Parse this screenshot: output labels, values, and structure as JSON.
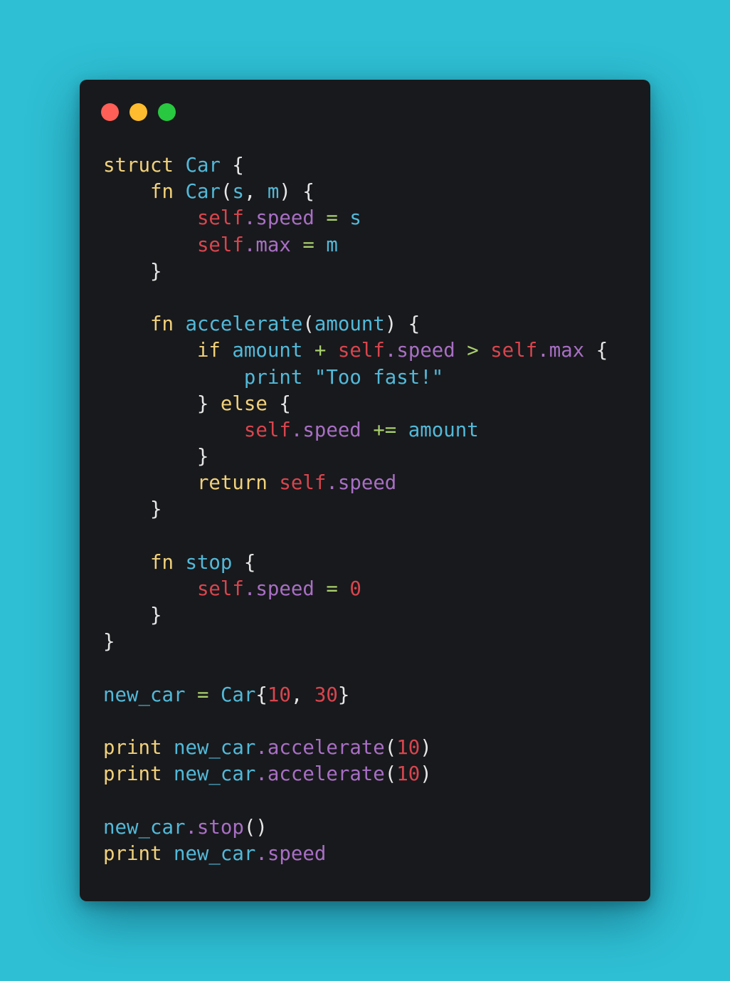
{
  "colors": {
    "background": "#2ebfd4",
    "window": "#18191c",
    "dot_red": "#ff5f57",
    "dot_yellow": "#febc2e",
    "dot_green": "#28c840",
    "plain": "#e6e6e6",
    "keyword": "#f1d17a",
    "name": "#52b9d9",
    "self": "#d8454e",
    "property": "#a86fc4",
    "operator": "#a9cf6d",
    "number": "#d8454e",
    "string": "#52b9d9"
  },
  "window": {
    "buttons": [
      {
        "name": "close-dot",
        "color": "#ff5f57"
      },
      {
        "name": "minimize-dot",
        "color": "#febc2e"
      },
      {
        "name": "maximize-dot",
        "color": "#28c840"
      }
    ]
  },
  "code_lines": [
    [
      [
        "k",
        "struct"
      ],
      [
        "w",
        " "
      ],
      [
        "n",
        "Car"
      ],
      [
        "w",
        " {"
      ]
    ],
    [
      [
        "w",
        "    "
      ],
      [
        "k",
        "fn"
      ],
      [
        "w",
        " "
      ],
      [
        "n",
        "Car"
      ],
      [
        "w",
        "("
      ],
      [
        "n",
        "s"
      ],
      [
        "w",
        ", "
      ],
      [
        "n",
        "m"
      ],
      [
        "w",
        ") {"
      ]
    ],
    [
      [
        "w",
        "        "
      ],
      [
        "s",
        "self"
      ],
      [
        "p",
        ".speed"
      ],
      [
        "w",
        " "
      ],
      [
        "o",
        "="
      ],
      [
        "w",
        " "
      ],
      [
        "n",
        "s"
      ]
    ],
    [
      [
        "w",
        "        "
      ],
      [
        "s",
        "self"
      ],
      [
        "p",
        ".max"
      ],
      [
        "w",
        " "
      ],
      [
        "o",
        "="
      ],
      [
        "w",
        " "
      ],
      [
        "n",
        "m"
      ]
    ],
    [
      [
        "w",
        "    }"
      ]
    ],
    [],
    [
      [
        "w",
        "    "
      ],
      [
        "k",
        "fn"
      ],
      [
        "w",
        " "
      ],
      [
        "n",
        "accelerate"
      ],
      [
        "w",
        "("
      ],
      [
        "n",
        "amount"
      ],
      [
        "w",
        ") {"
      ]
    ],
    [
      [
        "w",
        "        "
      ],
      [
        "k",
        "if"
      ],
      [
        "w",
        " "
      ],
      [
        "n",
        "amount"
      ],
      [
        "w",
        " "
      ],
      [
        "o",
        "+"
      ],
      [
        "w",
        " "
      ],
      [
        "s",
        "self"
      ],
      [
        "p",
        ".speed"
      ],
      [
        "w",
        " "
      ],
      [
        "o",
        ">"
      ],
      [
        "w",
        " "
      ],
      [
        "s",
        "self"
      ],
      [
        "p",
        ".max"
      ],
      [
        "w",
        " {"
      ]
    ],
    [
      [
        "w",
        "            "
      ],
      [
        "n",
        "print"
      ],
      [
        "w",
        " "
      ],
      [
        "t",
        "\"Too fast!\""
      ]
    ],
    [
      [
        "w",
        "        } "
      ],
      [
        "k",
        "else"
      ],
      [
        "w",
        " {"
      ]
    ],
    [
      [
        "w",
        "            "
      ],
      [
        "s",
        "self"
      ],
      [
        "p",
        ".speed"
      ],
      [
        "w",
        " "
      ],
      [
        "o",
        "+="
      ],
      [
        "w",
        " "
      ],
      [
        "n",
        "amount"
      ]
    ],
    [
      [
        "w",
        "        }"
      ]
    ],
    [
      [
        "w",
        "        "
      ],
      [
        "k",
        "return"
      ],
      [
        "w",
        " "
      ],
      [
        "s",
        "self"
      ],
      [
        "p",
        ".speed"
      ]
    ],
    [
      [
        "w",
        "    }"
      ]
    ],
    [],
    [
      [
        "w",
        "    "
      ],
      [
        "k",
        "fn"
      ],
      [
        "w",
        " "
      ],
      [
        "n",
        "stop"
      ],
      [
        "w",
        " {"
      ]
    ],
    [
      [
        "w",
        "        "
      ],
      [
        "s",
        "self"
      ],
      [
        "p",
        ".speed"
      ],
      [
        "w",
        " "
      ],
      [
        "o",
        "="
      ],
      [
        "w",
        " "
      ],
      [
        "d",
        "0"
      ]
    ],
    [
      [
        "w",
        "    }"
      ]
    ],
    [
      [
        "w",
        "}"
      ]
    ],
    [],
    [
      [
        "n",
        "new_car"
      ],
      [
        "w",
        " "
      ],
      [
        "o",
        "="
      ],
      [
        "w",
        " "
      ],
      [
        "n",
        "Car"
      ],
      [
        "w",
        "{"
      ],
      [
        "d",
        "10"
      ],
      [
        "w",
        ", "
      ],
      [
        "d",
        "30"
      ],
      [
        "w",
        "}"
      ]
    ],
    [],
    [
      [
        "k",
        "print"
      ],
      [
        "w",
        " "
      ],
      [
        "n",
        "new_car"
      ],
      [
        "p",
        ".accelerate"
      ],
      [
        "w",
        "("
      ],
      [
        "d",
        "10"
      ],
      [
        "w",
        ")"
      ]
    ],
    [
      [
        "k",
        "print"
      ],
      [
        "w",
        " "
      ],
      [
        "n",
        "new_car"
      ],
      [
        "p",
        ".accelerate"
      ],
      [
        "w",
        "("
      ],
      [
        "d",
        "10"
      ],
      [
        "w",
        ")"
      ]
    ],
    [],
    [
      [
        "n",
        "new_car"
      ],
      [
        "p",
        ".stop"
      ],
      [
        "w",
        "()"
      ]
    ],
    [
      [
        "k",
        "print"
      ],
      [
        "w",
        " "
      ],
      [
        "n",
        "new_car"
      ],
      [
        "p",
        ".speed"
      ]
    ]
  ]
}
